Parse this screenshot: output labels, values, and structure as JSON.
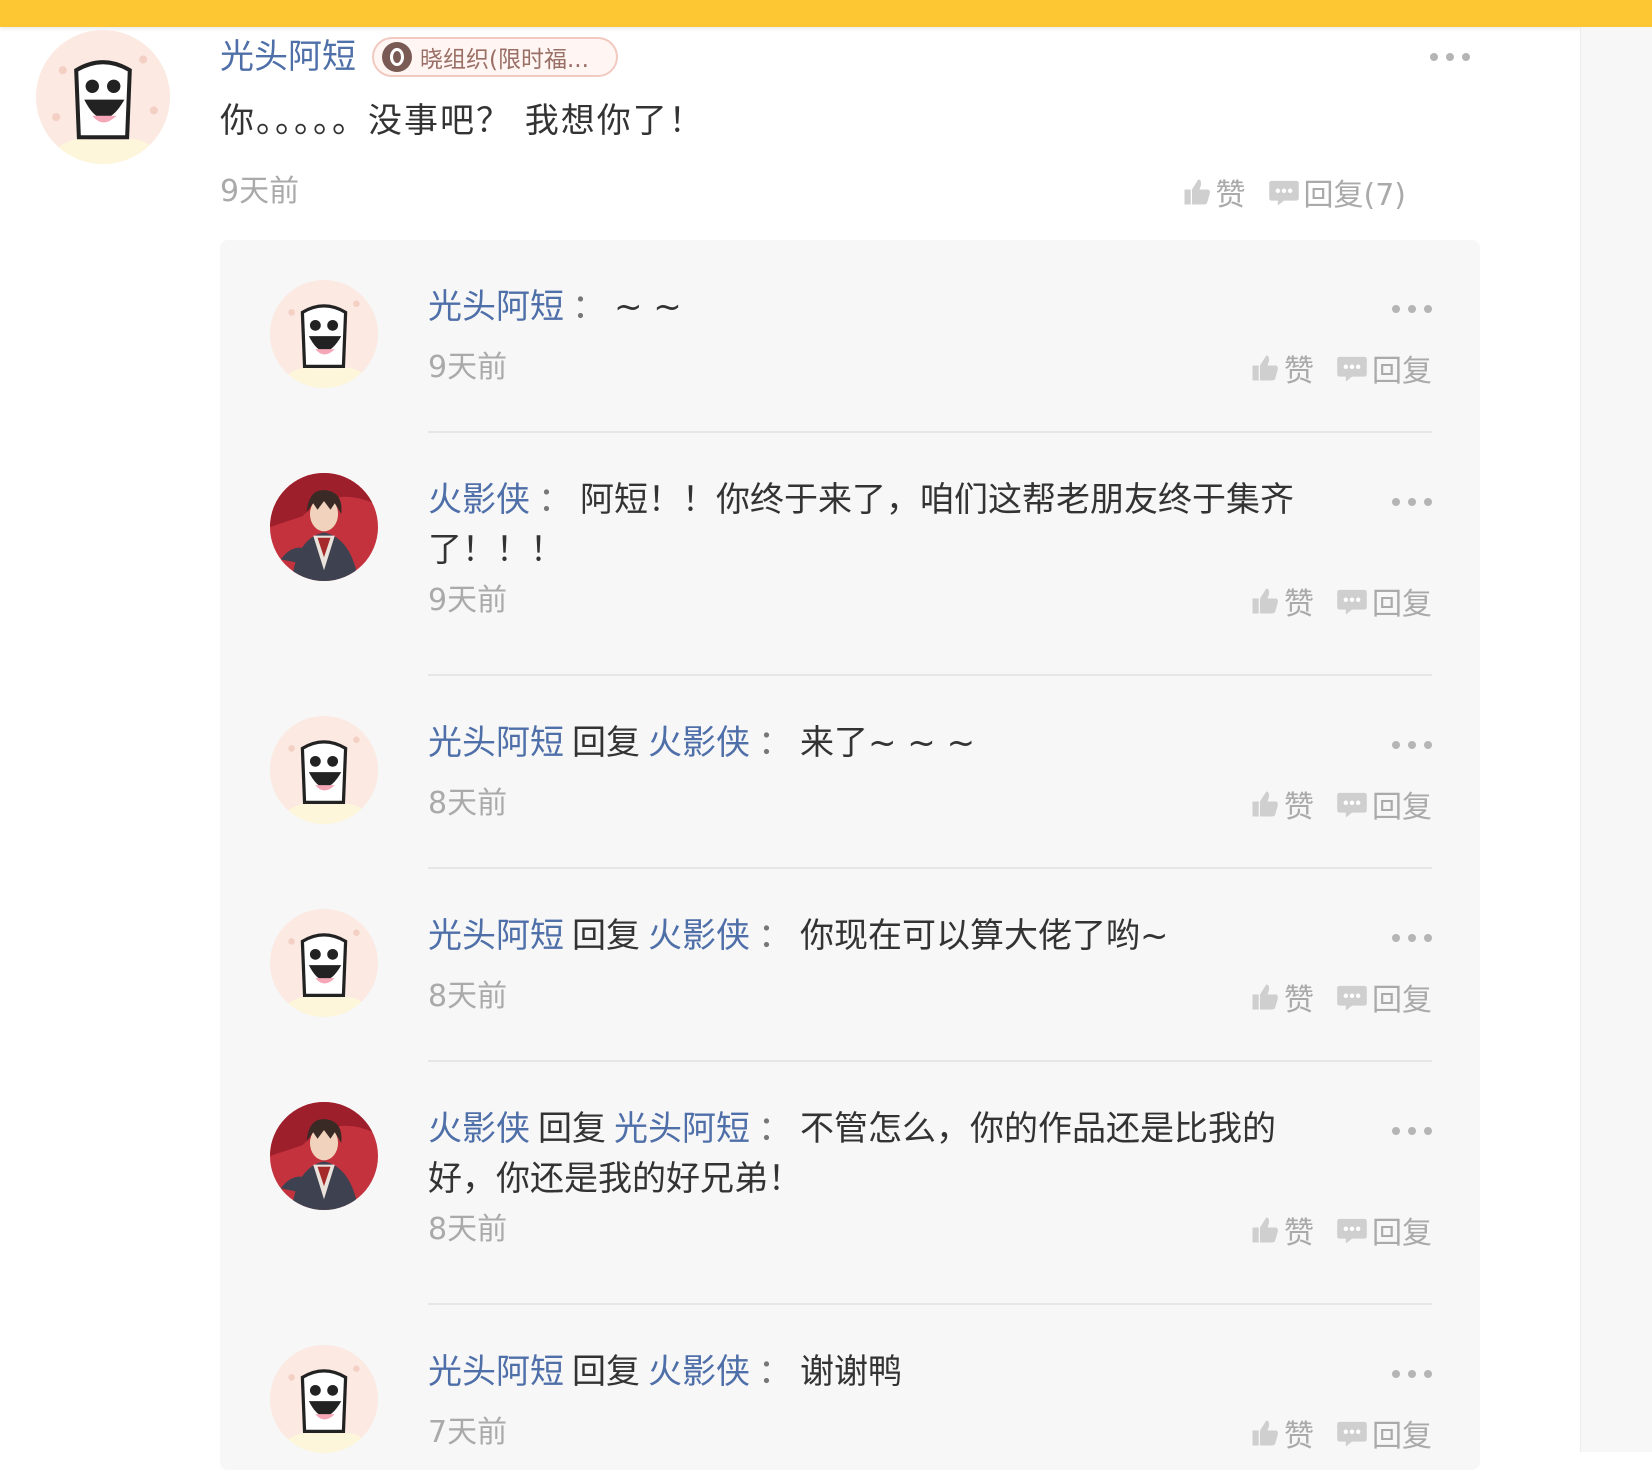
{
  "colors": {
    "top_bar": "#fdc633",
    "username": "#4f6fa9",
    "muted": "#aaaaaa",
    "panel_bg": "#f7f7f7"
  },
  "main_comment": {
    "author": "光头阿短",
    "badge": {
      "icon": "badge-o-icon",
      "text": "晓组织(限时福..."
    },
    "text": "你。。。。。没事吧？ 我想你了！",
    "time": "9天前",
    "like_label": "赞",
    "reply_label": "回复(7)"
  },
  "replies": [
    {
      "author": "光头阿短",
      "avatar": "toast-avatar",
      "reply_word": "",
      "target": "",
      "text": "~ ~",
      "time": "9天前",
      "like_label": "赞",
      "reply_label": "回复"
    },
    {
      "author": "火影侠",
      "avatar": "anime-avatar",
      "reply_word": "",
      "target": "",
      "text": "阿短！！你终于来了，咱们这帮老朋友终于集齐了！！！",
      "time": "9天前",
      "like_label": "赞",
      "reply_label": "回复"
    },
    {
      "author": "光头阿短",
      "avatar": "toast-avatar",
      "reply_word": "回复",
      "target": "火影侠",
      "text": "来了~ ~ ~",
      "time": "8天前",
      "like_label": "赞",
      "reply_label": "回复"
    },
    {
      "author": "光头阿短",
      "avatar": "toast-avatar",
      "reply_word": "回复",
      "target": "火影侠",
      "text": "你现在可以算大佬了哟~",
      "time": "8天前",
      "like_label": "赞",
      "reply_label": "回复"
    },
    {
      "author": "火影侠",
      "avatar": "anime-avatar",
      "reply_word": "回复",
      "target": "光头阿短",
      "text": "不管怎么，你的作品还是比我的好，你还是我的好兄弟！",
      "time": "8天前",
      "like_label": "赞",
      "reply_label": "回复"
    },
    {
      "author": "光头阿短",
      "avatar": "toast-avatar",
      "reply_word": "回复",
      "target": "火影侠",
      "text": "谢谢鸭",
      "time": "7天前",
      "like_label": "赞",
      "reply_label": "回复"
    }
  ]
}
